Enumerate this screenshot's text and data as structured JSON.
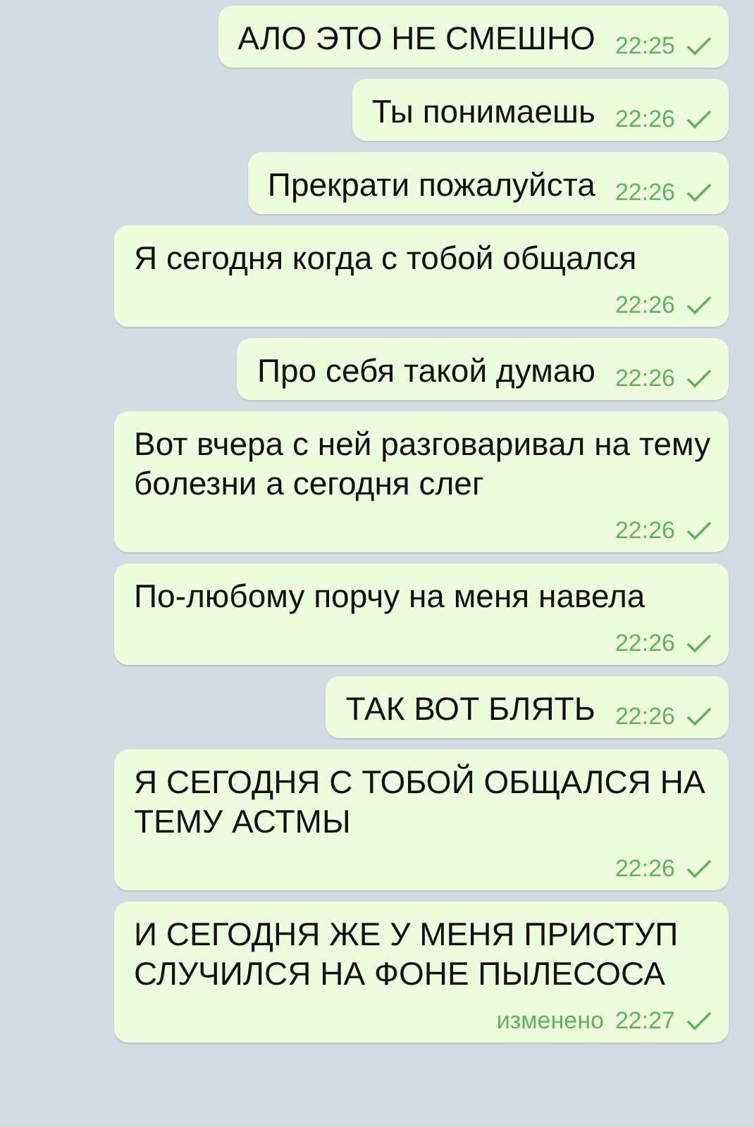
{
  "messages": [
    {
      "text": "АЛО ЭТО НЕ СМЕШНО",
      "time": "22:25",
      "read": false
    },
    {
      "text": "Ты понимаешь",
      "time": "22:26",
      "read": false
    },
    {
      "text": "Прекрати пожалуйста",
      "time": "22:26",
      "read": false
    },
    {
      "text": "Я сегодня когда с тобой общался",
      "time": "22:26",
      "read": false
    },
    {
      "text": "Про себя такой думаю",
      "time": "22:26",
      "read": false
    },
    {
      "text": "Вот вчера с ней разговаривал на тему болезни а сегодня слег",
      "time": "22:26",
      "read": false
    },
    {
      "text": "По-любому порчу на меня навела",
      "time": "22:26",
      "read": false
    },
    {
      "text": "ТАК ВОТ БЛЯТЬ",
      "time": "22:26",
      "read": false
    },
    {
      "text": "Я СЕГОДНЯ С ТОБОЙ ОБЩАЛСЯ НА ТЕМУ АСТМЫ",
      "time": "22:26",
      "read": false
    },
    {
      "text": "И СЕГОДНЯ ЖЕ У МЕНЯ ПРИСТУП СЛУЧИЛСЯ НА ФОНЕ ПЫЛЕСОСА",
      "time": "22:27",
      "edited": "изменено",
      "read": false
    }
  ]
}
